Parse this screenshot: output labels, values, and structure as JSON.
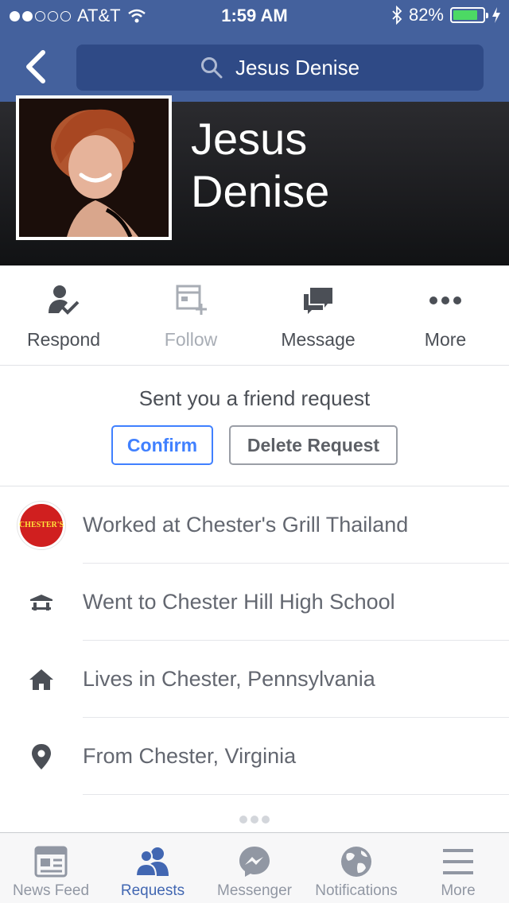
{
  "status_bar": {
    "carrier": "AT&T",
    "time": "1:59 AM",
    "battery": "82%",
    "battery_level": 0.82
  },
  "nav": {
    "search_value": "Jesus Denise"
  },
  "profile": {
    "name_line1": "Jesus",
    "name_line2": "Denise"
  },
  "actions": [
    {
      "label": "Respond",
      "icon": "respond-person-check-icon"
    },
    {
      "label": "Follow",
      "icon": "follow-feed-plus-icon"
    },
    {
      "label": "Message",
      "icon": "message-bubbles-icon"
    },
    {
      "label": "More",
      "icon": "more-dots-icon"
    }
  ],
  "friend_request": {
    "text": "Sent you a friend request",
    "confirm_label": "Confirm",
    "delete_label": "Delete Request"
  },
  "info": [
    {
      "text": "Worked at Chester's Grill Thailand",
      "icon": "chesters-logo"
    },
    {
      "text": "Went to Chester Hill High School",
      "icon": "school-icon"
    },
    {
      "text": "Lives in Chester, Pennsylvania",
      "icon": "home-icon"
    },
    {
      "text": "From Chester, Virginia",
      "icon": "location-pin-icon"
    }
  ],
  "tabs": [
    {
      "label": "News Feed",
      "icon": "news-feed-icon",
      "active": false
    },
    {
      "label": "Requests",
      "icon": "requests-icon",
      "active": true
    },
    {
      "label": "Messenger",
      "icon": "messenger-icon",
      "active": false
    },
    {
      "label": "Notifications",
      "icon": "globe-icon",
      "active": false
    },
    {
      "label": "More",
      "icon": "hamburger-icon",
      "active": false
    }
  ],
  "colors": {
    "header": "#44619d",
    "accent": "#4267b2",
    "confirm": "#4080ff",
    "battery_fill": "#4cd964"
  }
}
